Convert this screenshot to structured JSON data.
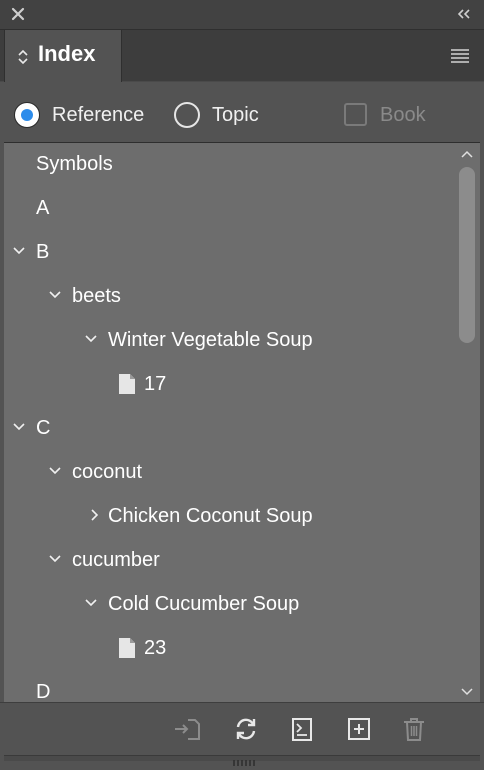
{
  "panel": {
    "tab_label": "Index"
  },
  "options": {
    "reference_label": "Reference",
    "topic_label": "Topic",
    "book_label": "Book",
    "selected": "Reference",
    "accent_color": "#2d8ceb"
  },
  "entries": {
    "symbols": "Symbols",
    "a": "A",
    "b": "B",
    "beets": "beets",
    "winter_soup": "Winter Vegetable Soup",
    "page_17": "17",
    "c": "C",
    "coconut": "coconut",
    "chicken_soup": "Chicken Coconut Soup",
    "cucumber": "cucumber",
    "cold_soup": "Cold Cucumber Soup",
    "page_23": "23",
    "d": "D"
  },
  "footer_icons": [
    "go-to-marker-icon",
    "refresh-icon",
    "new-index-icon",
    "add-entry-icon",
    "trash-icon"
  ]
}
